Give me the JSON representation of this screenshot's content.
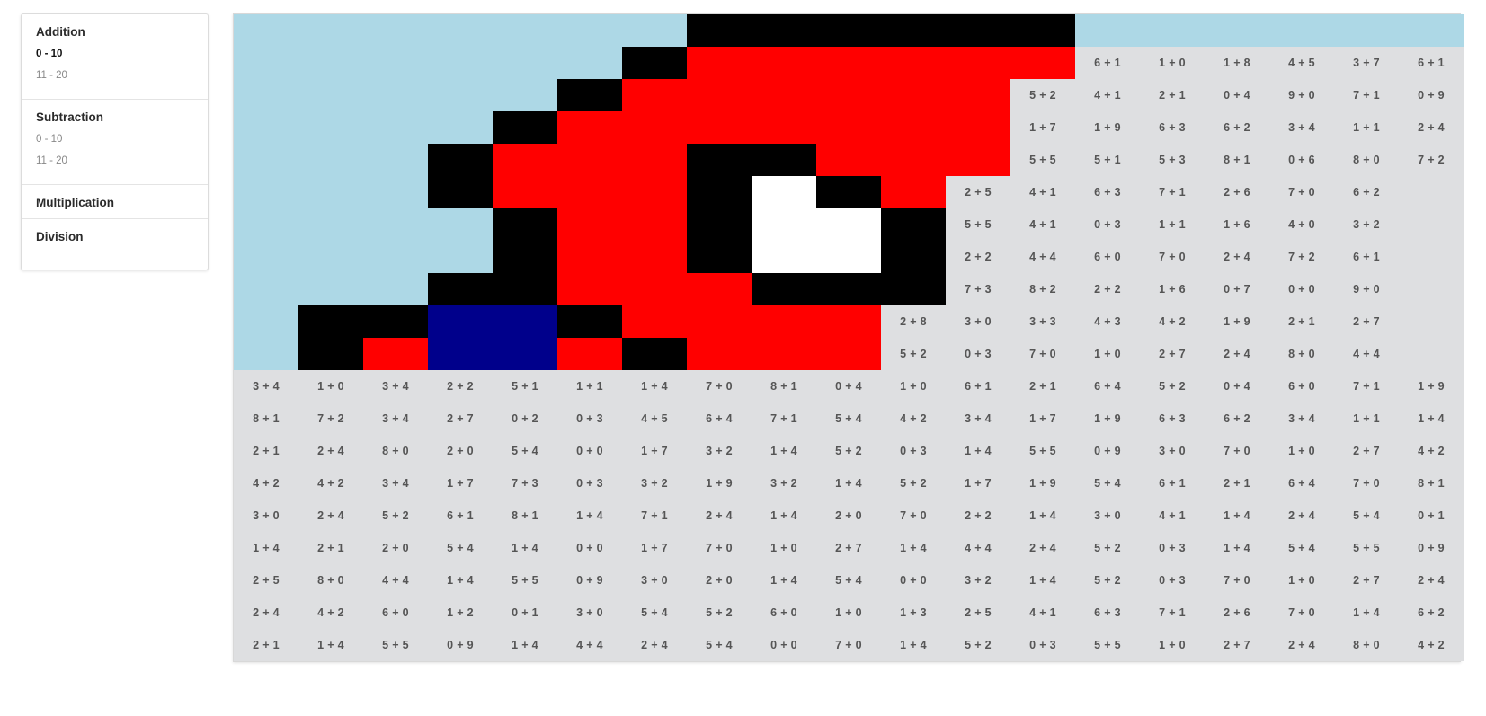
{
  "sidebar": {
    "sections": [
      {
        "title": "Addition",
        "items": [
          {
            "label": "0 - 10",
            "active": true
          },
          {
            "label": "11 - 20",
            "active": false
          }
        ]
      },
      {
        "title": "Subtraction",
        "items": [
          {
            "label": "0 - 10",
            "active": false
          },
          {
            "label": "11 - 20",
            "active": false
          }
        ]
      },
      {
        "title": "Multiplication",
        "items": []
      },
      {
        "title": "Division",
        "items": []
      }
    ]
  },
  "colors": {
    "B": "#add8e6",
    "K": "#000000",
    "R": "#ff0000",
    "W": "#ffffff",
    "N": "#00008b",
    "gray": "#dedfe1",
    "text": "#555555"
  },
  "pixel_art": [
    "BBBBBBBKKKKKKBBBBBB",
    "BBBBBBKRRRRRR      ",
    "BBBBBKRRRRRR       ",
    "BBBBKRRRRRRR       ",
    "BBBKRRRKKRRR       ",
    "BBBKRRRKWKR        ",
    "BBBBKRRKWWK        ",
    "BBBBKRRKWWK        ",
    "BBBKKRRRKKK        ",
    "BKKNNKRRRR         ",
    "BKRNNRKRRR         "
  ],
  "problems": [
    [
      "",
      "",
      "",
      "",
      "",
      "",
      "",
      "",
      "",
      "",
      "",
      "",
      "",
      "",
      "",
      "",
      "",
      "",
      ""
    ],
    [
      "",
      "",
      "",
      "",
      "",
      "",
      "",
      "",
      "",
      "",
      "",
      "",
      "",
      "6 + 1",
      "1 + 0",
      "1 + 8",
      "4 + 5",
      "3 + 7",
      "6 + 1"
    ],
    [
      "",
      "",
      "",
      "",
      "",
      "",
      "",
      "",
      "",
      "",
      "",
      "",
      "5 + 2",
      "4 + 1",
      "2 + 1",
      "0 + 4",
      "9 + 0",
      "7 + 1",
      "0 + 9"
    ],
    [
      "",
      "",
      "",
      "",
      "",
      "",
      "",
      "",
      "",
      "",
      "",
      "",
      "1 + 7",
      "1 + 9",
      "6 + 3",
      "6 + 2",
      "3 + 4",
      "1 + 1",
      "2 + 4"
    ],
    [
      "",
      "",
      "",
      "",
      "",
      "",
      "",
      "",
      "",
      "",
      "",
      "",
      "5 + 5",
      "5 + 1",
      "5 + 3",
      "8 + 1",
      "0 + 6",
      "8 + 0",
      "7 + 2"
    ],
    [
      "",
      "",
      "",
      "",
      "",
      "",
      "",
      "",
      "",
      "",
      "",
      "2 + 5",
      "4 + 1",
      "6 + 3",
      "7 + 1",
      "2 + 6",
      "7 + 0",
      "6 + 2",
      ""
    ],
    [
      "",
      "",
      "",
      "",
      "",
      "",
      "",
      "",
      "",
      "",
      "",
      "5 + 5",
      "4 + 1",
      "0 + 3",
      "1 + 1",
      "1 + 6",
      "4 + 0",
      "3 + 2",
      ""
    ],
    [
      "",
      "",
      "",
      "",
      "",
      "",
      "",
      "",
      "",
      "",
      "",
      "2 + 2",
      "4 + 4",
      "6 + 0",
      "7 + 0",
      "2 + 4",
      "7 + 2",
      "6 + 1",
      ""
    ],
    [
      "",
      "",
      "",
      "",
      "",
      "",
      "",
      "",
      "",
      "",
      "",
      "7 + 3",
      "8 + 2",
      "2 + 2",
      "1 + 6",
      "0 + 7",
      "0 + 0",
      "9 + 0",
      ""
    ],
    [
      "",
      "",
      "",
      "",
      "",
      "",
      "",
      "",
      "",
      "",
      "2 + 8",
      "3 + 0",
      "3 + 3",
      "4 + 3",
      "4 + 2",
      "1 + 9",
      "2 + 1",
      "2 + 7",
      ""
    ],
    [
      "",
      "",
      "",
      "",
      "",
      "",
      "",
      "",
      "",
      "",
      "5 + 2",
      "0 + 3",
      "7 + 0",
      "1 + 0",
      "2 + 7",
      "2 + 4",
      "8 + 0",
      "4 + 4",
      ""
    ],
    [
      "3 + 4",
      "1 + 0",
      "3 + 4",
      "2 + 2",
      "5 + 1",
      "1 + 1",
      "1 + 4",
      "7 + 0",
      "8 + 1",
      "0 + 4",
      "1 + 0",
      "6 + 1",
      "2 + 1",
      "6 + 4",
      "5 + 2",
      "0 + 4",
      "6 + 0",
      "7 + 1",
      "1 + 9"
    ],
    [
      "8 + 1",
      "7 + 2",
      "3 + 4",
      "2 + 7",
      "0 + 2",
      "0 + 3",
      "4 + 5",
      "6 + 4",
      "7 + 1",
      "5 + 4",
      "4 + 2",
      "3 + 4",
      "1 + 7",
      "1 + 9",
      "6 + 3",
      "6 + 2",
      "3 + 4",
      "1 + 1",
      "1 + 4"
    ],
    [
      "2 + 1",
      "2 + 4",
      "8 + 0",
      "2 + 0",
      "5 + 4",
      "0 + 0",
      "1 + 7",
      "3 + 2",
      "1 + 4",
      "5 + 2",
      "0 + 3",
      "1 + 4",
      "5 + 5",
      "0 + 9",
      "3 + 0",
      "7 + 0",
      "1 + 0",
      "2 + 7",
      "4 + 2"
    ],
    [
      "4 + 2",
      "4 + 2",
      "3 + 4",
      "1 + 7",
      "7 + 3",
      "0 + 3",
      "3 + 2",
      "1 + 9",
      "3 + 2",
      "1 + 4",
      "5 + 2",
      "1 + 7",
      "1 + 9",
      "5 + 4",
      "6 + 1",
      "2 + 1",
      "6 + 4",
      "7 + 0",
      "8 + 1"
    ],
    [
      "3 + 0",
      "2 + 4",
      "5 + 2",
      "6 + 1",
      "8 + 1",
      "1 + 4",
      "7 + 1",
      "2 + 4",
      "1 + 4",
      "2 + 0",
      "7 + 0",
      "2 + 2",
      "1 + 4",
      "3 + 0",
      "4 + 1",
      "1 + 4",
      "2 + 4",
      "5 + 4",
      "0 + 1"
    ],
    [
      "1 + 4",
      "2 + 1",
      "2 + 0",
      "5 + 4",
      "1 + 4",
      "0 + 0",
      "1 + 7",
      "7 + 0",
      "1 + 0",
      "2 + 7",
      "1 + 4",
      "4 + 4",
      "2 + 4",
      "5 + 2",
      "0 + 3",
      "1 + 4",
      "5 + 4",
      "5 + 5",
      "0 + 9"
    ],
    [
      "2 + 5",
      "8 + 0",
      "4 + 4",
      "1 + 4",
      "5 + 5",
      "0 + 9",
      "3 + 0",
      "2 + 0",
      "1 + 4",
      "5 + 4",
      "0 + 0",
      "3 + 2",
      "1 + 4",
      "5 + 2",
      "0 + 3",
      "7 + 0",
      "1 + 0",
      "2 + 7",
      "2 + 4"
    ],
    [
      "2 + 4",
      "4 + 2",
      "6 + 0",
      "1 + 2",
      "0 + 1",
      "3 + 0",
      "5 + 4",
      "5 + 2",
      "6 + 0",
      "1 + 0",
      "1 + 3",
      "2 + 5",
      "4 + 1",
      "6 + 3",
      "7 + 1",
      "2 + 6",
      "7 + 0",
      "1 + 4",
      "6 + 2"
    ],
    [
      "2 + 1",
      "1 + 4",
      "5 + 5",
      "0 + 9",
      "1 + 4",
      "4 + 4",
      "2 + 4",
      "5 + 4",
      "0 + 0",
      "7 + 0",
      "1 + 4",
      "5 + 2",
      "0 + 3",
      "5 + 5",
      "1 + 0",
      "2 + 7",
      "2 + 4",
      "8 + 0",
      "4 + 2"
    ]
  ]
}
